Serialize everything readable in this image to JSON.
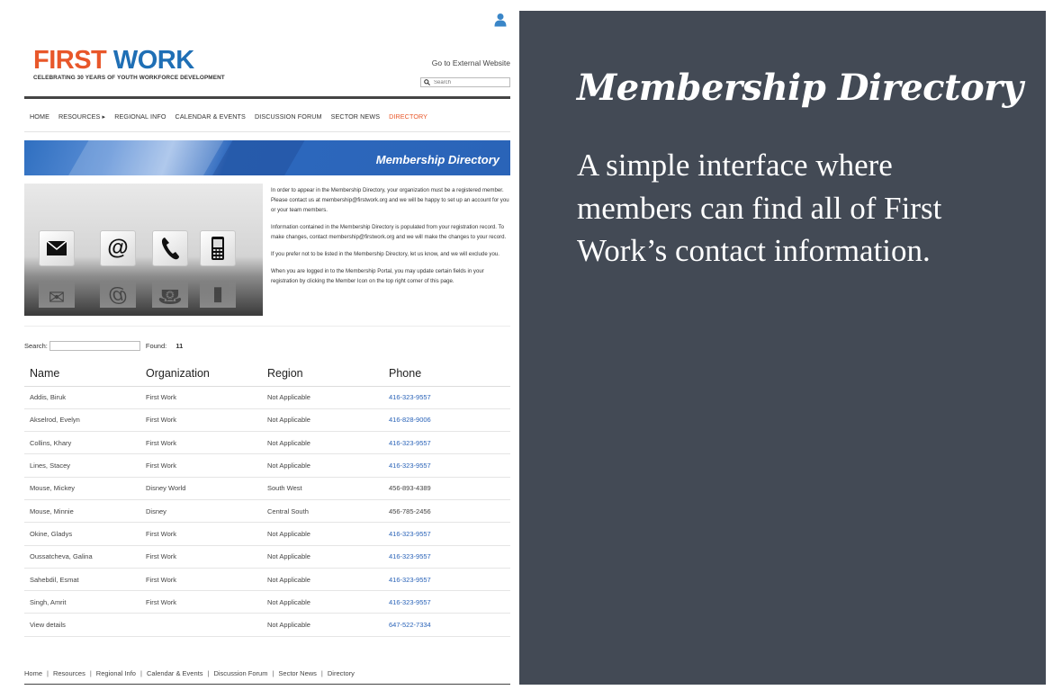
{
  "site": {
    "logo": {
      "first": "FIRST",
      "work": "WORK"
    },
    "tagline": "CELEBRATING 30 YEARS OF YOUTH WORKFORCE DEVELOPMENT",
    "external_link": "Go to External Website",
    "search_placeholder": "Search",
    "nav": {
      "home": "HOME",
      "resources": "RESOURCES ▸",
      "regional": "REGIONAL INFO",
      "calendar": "CALENDAR & EVENTS",
      "forum": "DISCUSSION FORUM",
      "news": "SECTOR NEWS",
      "directory": "DIRECTORY"
    },
    "banner_title": "Membership Directory",
    "intro": [
      "In order to appear in the Membership Directory, your organization must be a registered member.  Please contact us at membership@firstwork.org and we will be happy to set up an account for you or your team members.",
      "Information contained in the Membership Directory is populated from your registration record. To make changes, contact membership@firstwork.org and we will make the changes to your record.",
      "If you prefer not to be listed in the Membership Directory, let us know, and we will exclude you.",
      "When you are logged in to the Membership Portal, you may update certain fields in your registration by clicking the Member Icon on the top right corner of this page."
    ],
    "directory": {
      "search_label": "Search:",
      "found_label": "Found:",
      "found_count": "11",
      "headers": {
        "name": "Name",
        "org": "Organization",
        "region": "Region",
        "phone": "Phone"
      },
      "rows": [
        {
          "name": "Addis, Biruk",
          "org": "First Work",
          "region": "Not Applicable",
          "phone": "416-323-9557"
        },
        {
          "name": "Akselrod, Evelyn",
          "org": "First Work",
          "region": "Not Applicable",
          "phone": "416-828-9006"
        },
        {
          "name": "Collins, Khary",
          "org": "First Work",
          "region": "Not Applicable",
          "phone": "416-323-9557"
        },
        {
          "name": "Lines, Stacey",
          "org": "First Work",
          "region": "Not Applicable",
          "phone": "416-323-9557"
        },
        {
          "name": "Mouse, Mickey",
          "org": "Disney World",
          "region": "South West",
          "phone": "456-893-4389"
        },
        {
          "name": "Mouse, Minnie",
          "org": "Disney",
          "region": "Central South",
          "phone": "456-785-2456"
        },
        {
          "name": "Okine, Gladys",
          "org": "First Work",
          "region": "Not Applicable",
          "phone": "416-323-9557"
        },
        {
          "name": "Oussatcheva, Galina",
          "org": "First Work",
          "region": "Not Applicable",
          "phone": "416-323-9557"
        },
        {
          "name": "Sahebdil, Esmat",
          "org": "First Work",
          "region": "Not Applicable",
          "phone": "416-323-9557"
        },
        {
          "name": "Singh, Amrit",
          "org": "First Work",
          "region": "Not Applicable",
          "phone": "416-323-9557"
        },
        {
          "name": "View details",
          "org": "",
          "region": "Not Applicable",
          "phone": "647-522-7334"
        }
      ]
    },
    "footer": {
      "home": "Home",
      "resources": "Resources",
      "regional": "Regional Info",
      "calendar": "Calendar & Events",
      "forum": "Discussion Forum",
      "news": "Sector News",
      "directory": "Directory",
      "separator": "|"
    }
  },
  "promo": {
    "title": "Membership Directory",
    "description": "A simple interface where members can find all of First Work’s contact information."
  },
  "colors": {
    "brand_orange": "#e8572a",
    "brand_blue": "#1f6fb5",
    "link_blue": "#2a63b8",
    "panel_bg": "#434a55"
  }
}
